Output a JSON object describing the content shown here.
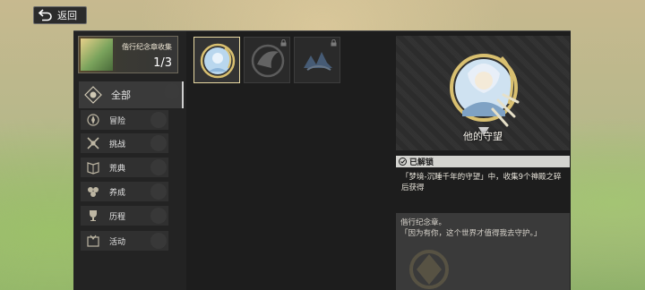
{
  "header": {
    "back_label": "返回"
  },
  "collection": {
    "title": "偕行纪念章收集",
    "count": "1/3"
  },
  "categories": [
    {
      "label": "全部",
      "icon": "all-icon"
    },
    {
      "label": "冒险",
      "icon": "adventure-icon"
    },
    {
      "label": "挑战",
      "icon": "challenge-icon"
    },
    {
      "label": "荒典",
      "icon": "codex-icon"
    },
    {
      "label": "养成",
      "icon": "growth-icon"
    },
    {
      "label": "历程",
      "icon": "trophy-icon"
    },
    {
      "label": "活动",
      "icon": "event-icon"
    }
  ],
  "badges": [
    {
      "state": "unlocked",
      "icon": "guardian-badge-icon"
    },
    {
      "state": "locked",
      "icon": "wing-badge-icon"
    },
    {
      "state": "locked",
      "icon": "crystal-badge-icon"
    }
  ],
  "detail": {
    "name": "他的守望",
    "status": "已解锁",
    "condition": "「梦境-沉睡千年的守望」中，收集9个神殿之碎后获得",
    "desc_line1": "偕行纪念章。",
    "desc_line2": "「因为有你，这个世界才值得我去守护。」"
  },
  "colors": {
    "panel": "#1d1d1d",
    "accent_gold": "#e8d9a2",
    "unlocked_tag": "#d4d4d0"
  }
}
